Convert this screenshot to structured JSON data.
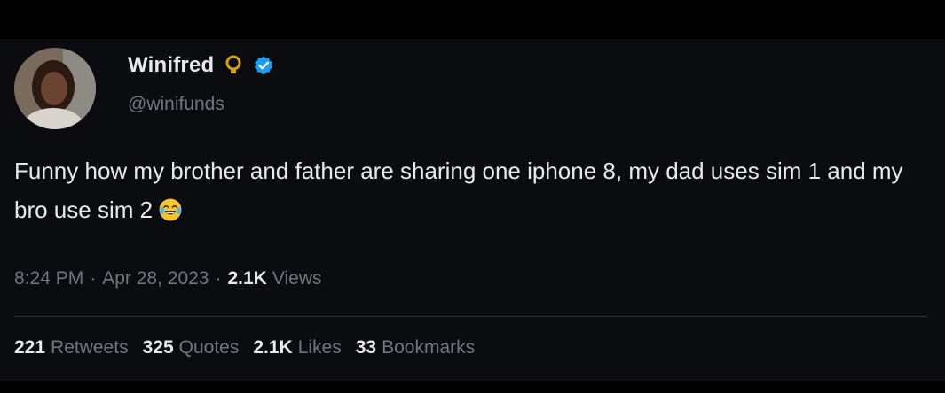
{
  "author": {
    "display_name": "Winifred",
    "handle": "@winifunds",
    "avatar_icon": "profile-photo",
    "badges": [
      "lightbulb-icon",
      "verified-badge-icon"
    ],
    "verified_color": "#1d9bf0",
    "lightbulb_color": "#d4a017"
  },
  "tweet": {
    "text": "Funny how my brother and father are sharing one iphone 8, my dad uses sim 1 and my bro use sim 2",
    "emoji": "laughing-tears-emoji"
  },
  "meta": {
    "time": "8:24 PM",
    "dot": "·",
    "date": "Apr 28, 2023",
    "views_count": "2.1K",
    "views_label": "Views"
  },
  "stats": [
    {
      "count": "221",
      "label": "Retweets"
    },
    {
      "count": "325",
      "label": "Quotes"
    },
    {
      "count": "2.1K",
      "label": "Likes"
    },
    {
      "count": "33",
      "label": "Bookmarks"
    }
  ],
  "colors": {
    "background": "#000000",
    "card": "#0b0c0f",
    "primary_text": "#e7e9ea",
    "secondary_text": "#71767b",
    "divider": "#2f3336"
  }
}
